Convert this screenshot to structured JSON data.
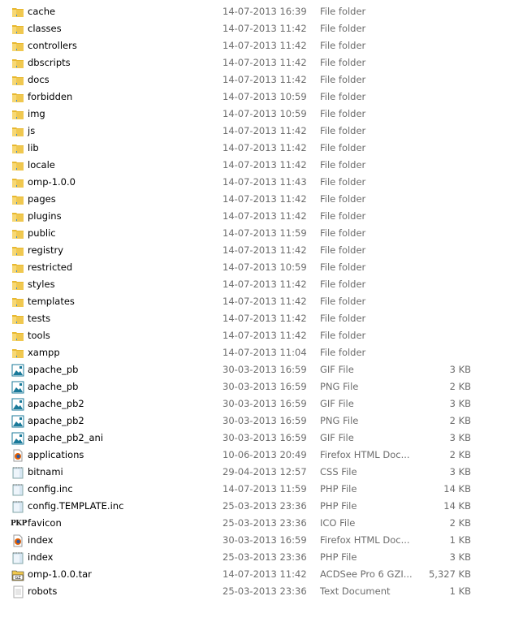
{
  "files": [
    {
      "name": "cache",
      "date": "14-07-2013 16:39",
      "type": "File folder",
      "size": "",
      "icon": "folder-icon"
    },
    {
      "name": "classes",
      "date": "14-07-2013 11:42",
      "type": "File folder",
      "size": "",
      "icon": "folder-icon"
    },
    {
      "name": "controllers",
      "date": "14-07-2013 11:42",
      "type": "File folder",
      "size": "",
      "icon": "folder-icon"
    },
    {
      "name": "dbscripts",
      "date": "14-07-2013 11:42",
      "type": "File folder",
      "size": "",
      "icon": "folder-icon"
    },
    {
      "name": "docs",
      "date": "14-07-2013 11:42",
      "type": "File folder",
      "size": "",
      "icon": "folder-icon"
    },
    {
      "name": "forbidden",
      "date": "14-07-2013 10:59",
      "type": "File folder",
      "size": "",
      "icon": "folder-icon"
    },
    {
      "name": "img",
      "date": "14-07-2013 10:59",
      "type": "File folder",
      "size": "",
      "icon": "folder-icon"
    },
    {
      "name": "js",
      "date": "14-07-2013 11:42",
      "type": "File folder",
      "size": "",
      "icon": "folder-icon"
    },
    {
      "name": "lib",
      "date": "14-07-2013 11:42",
      "type": "File folder",
      "size": "",
      "icon": "folder-icon"
    },
    {
      "name": "locale",
      "date": "14-07-2013 11:42",
      "type": "File folder",
      "size": "",
      "icon": "folder-icon"
    },
    {
      "name": "omp-1.0.0",
      "date": "14-07-2013 11:43",
      "type": "File folder",
      "size": "",
      "icon": "folder-icon"
    },
    {
      "name": "pages",
      "date": "14-07-2013 11:42",
      "type": "File folder",
      "size": "",
      "icon": "folder-icon"
    },
    {
      "name": "plugins",
      "date": "14-07-2013 11:42",
      "type": "File folder",
      "size": "",
      "icon": "folder-icon"
    },
    {
      "name": "public",
      "date": "14-07-2013 11:59",
      "type": "File folder",
      "size": "",
      "icon": "folder-icon"
    },
    {
      "name": "registry",
      "date": "14-07-2013 11:42",
      "type": "File folder",
      "size": "",
      "icon": "folder-icon"
    },
    {
      "name": "restricted",
      "date": "14-07-2013 10:59",
      "type": "File folder",
      "size": "",
      "icon": "folder-icon"
    },
    {
      "name": "styles",
      "date": "14-07-2013 11:42",
      "type": "File folder",
      "size": "",
      "icon": "folder-icon"
    },
    {
      "name": "templates",
      "date": "14-07-2013 11:42",
      "type": "File folder",
      "size": "",
      "icon": "folder-icon"
    },
    {
      "name": "tests",
      "date": "14-07-2013 11:42",
      "type": "File folder",
      "size": "",
      "icon": "folder-icon"
    },
    {
      "name": "tools",
      "date": "14-07-2013 11:42",
      "type": "File folder",
      "size": "",
      "icon": "folder-icon"
    },
    {
      "name": "xampp",
      "date": "14-07-2013 11:04",
      "type": "File folder",
      "size": "",
      "icon": "folder-icon"
    },
    {
      "name": "apache_pb",
      "date": "30-03-2013 16:59",
      "type": "GIF File",
      "size": "3 KB",
      "icon": "image-file-icon"
    },
    {
      "name": "apache_pb",
      "date": "30-03-2013 16:59",
      "type": "PNG File",
      "size": "2 KB",
      "icon": "image-file-icon"
    },
    {
      "name": "apache_pb2",
      "date": "30-03-2013 16:59",
      "type": "GIF File",
      "size": "3 KB",
      "icon": "image-file-icon"
    },
    {
      "name": "apache_pb2",
      "date": "30-03-2013 16:59",
      "type": "PNG File",
      "size": "2 KB",
      "icon": "image-file-icon"
    },
    {
      "name": "apache_pb2_ani",
      "date": "30-03-2013 16:59",
      "type": "GIF File",
      "size": "3 KB",
      "icon": "image-file-icon"
    },
    {
      "name": "applications",
      "date": "10-06-2013 20:49",
      "type": "Firefox HTML Doc...",
      "size": "2 KB",
      "icon": "firefox-document-icon"
    },
    {
      "name": "bitnami",
      "date": "29-04-2013 12:57",
      "type": "CSS File",
      "size": "3 KB",
      "icon": "notepad-file-icon"
    },
    {
      "name": "config.inc",
      "date": "14-07-2013 11:59",
      "type": "PHP File",
      "size": "14 KB",
      "icon": "notepad-file-icon"
    },
    {
      "name": "config.TEMPLATE.inc",
      "date": "25-03-2013 23:36",
      "type": "PHP File",
      "size": "14 KB",
      "icon": "notepad-file-icon"
    },
    {
      "name": "favicon",
      "date": "25-03-2013 23:36",
      "type": "ICO File",
      "size": "2 KB",
      "icon": "pkp-icon",
      "icon_text": "PKP"
    },
    {
      "name": "index",
      "date": "30-03-2013 16:59",
      "type": "Firefox HTML Doc...",
      "size": "1 KB",
      "icon": "firefox-document-icon"
    },
    {
      "name": "index",
      "date": "25-03-2013 23:36",
      "type": "PHP File",
      "size": "3 KB",
      "icon": "notepad-file-icon"
    },
    {
      "name": "omp-1.0.0.tar",
      "date": "14-07-2013 11:42",
      "type": "ACDSee Pro 6 GZI...",
      "size": "5,327 KB",
      "icon": "gz-archive-icon",
      "icon_text": "GZ"
    },
    {
      "name": "robots",
      "date": "25-03-2013 23:36",
      "type": "Text Document",
      "size": "1 KB",
      "icon": "text-document-icon"
    }
  ]
}
